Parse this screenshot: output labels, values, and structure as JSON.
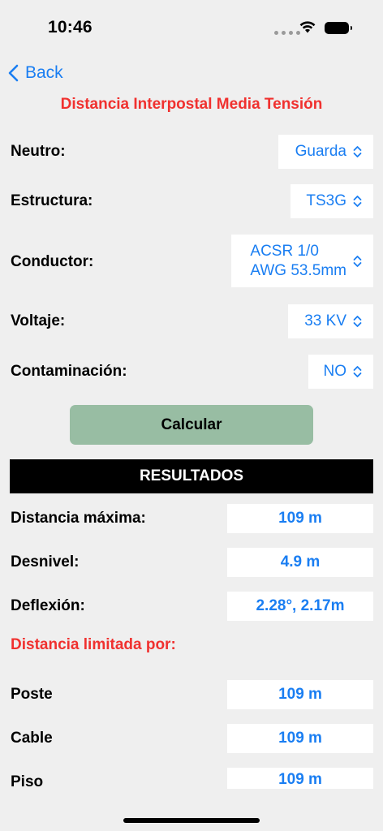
{
  "status": {
    "time": "10:46"
  },
  "nav": {
    "back_label": "Back"
  },
  "header": {
    "title": "Distancia Interpostal Media Tensión"
  },
  "form": {
    "neutro": {
      "label": "Neutro:",
      "value": "Guarda"
    },
    "estructura": {
      "label": "Estructura:",
      "value": "TS3G"
    },
    "conductor": {
      "label": "Conductor:",
      "value_line1": "ACSR 1/0",
      "value_line2": "AWG 53.5mm"
    },
    "voltaje": {
      "label": "Voltaje:",
      "value": "33 KV"
    },
    "contaminacion": {
      "label": "Contaminación:",
      "value": "NO"
    }
  },
  "actions": {
    "calculate_label": "Calcular"
  },
  "results": {
    "header": "RESULTADOS",
    "distancia_maxima": {
      "label": "Distancia máxima:",
      "value": "109 m"
    },
    "desnivel": {
      "label": "Desnivel:",
      "value": "4.9 m"
    },
    "deflexion": {
      "label": "Deflexión:",
      "value": "2.28°, 2.17m"
    }
  },
  "limited_by": {
    "title": "Distancia limitada por:",
    "poste": {
      "label": "Poste",
      "value": "109 m"
    },
    "cable": {
      "label": "Cable",
      "value": "109 m"
    },
    "piso": {
      "label": "Piso",
      "value": "109 m"
    }
  },
  "colors": {
    "accent": "#1a7ef2",
    "title_red": "#f0312f",
    "button_green": "#98bda3",
    "background": "#efefef"
  }
}
